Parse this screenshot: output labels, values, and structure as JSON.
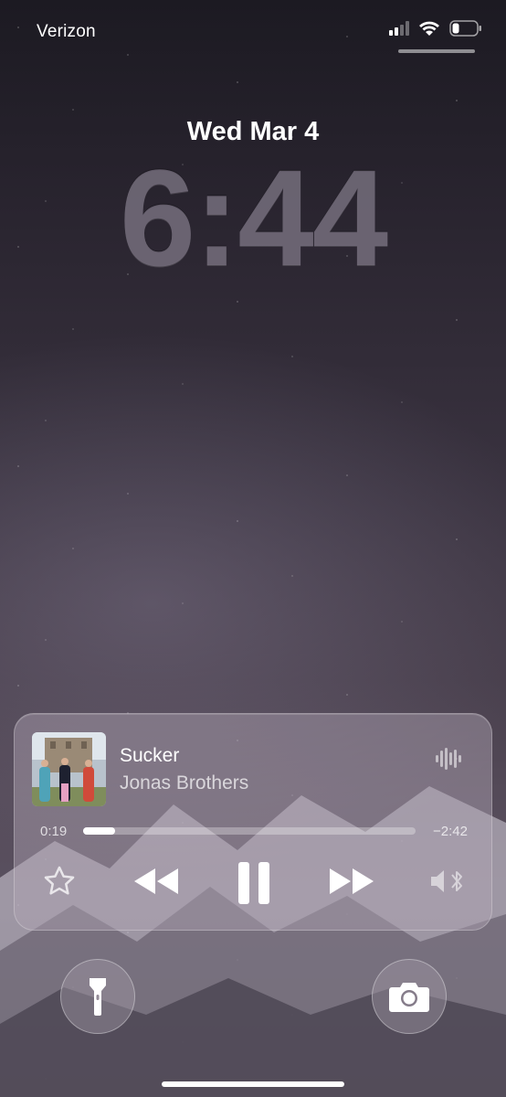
{
  "status_bar": {
    "carrier": "Verizon",
    "icons": [
      "cellular-signal-icon",
      "wifi-icon",
      "battery-icon"
    ]
  },
  "lock_screen": {
    "date": "Wed Mar 4",
    "time": "6:44"
  },
  "now_playing": {
    "title": "Sucker",
    "artist": "Jonas Brothers",
    "elapsed": "0:19",
    "remaining": "−2:42",
    "progress_fraction": 0.095,
    "controls": [
      "star-icon",
      "rewind-icon",
      "pause-icon",
      "fast-forward-icon",
      "bluetooth-audio-icon"
    ]
  },
  "quick_actions": [
    "flashlight-icon",
    "camera-icon"
  ],
  "colors": {
    "text": "#ffffff",
    "player_bg": "rgba(175,165,180,0.45)"
  }
}
